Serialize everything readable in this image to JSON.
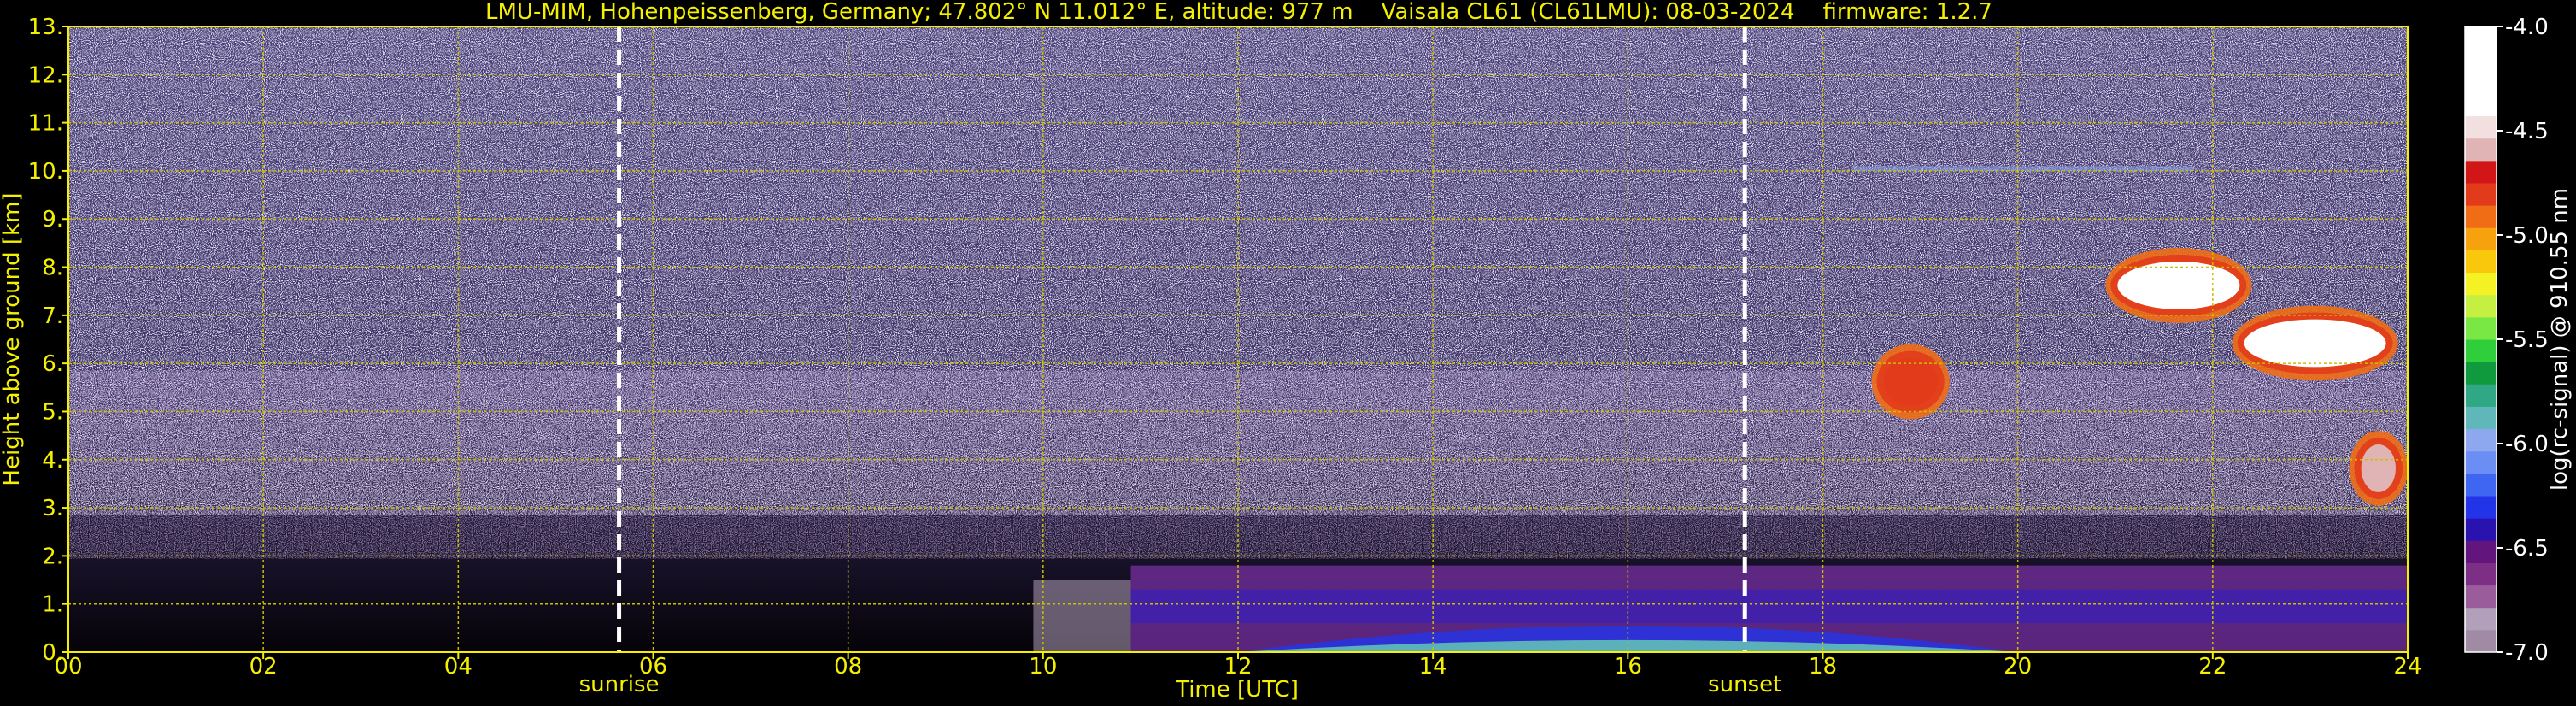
{
  "chart_data": {
    "type": "heatmap",
    "title": "LMU-MIM, Hohenpeissenberg, Germany; 47.802° N 11.012° E, altitude: 977 m    Vaisala CL61 (CL61LMU): 08-03-2024    firmware: 1.2.7",
    "xlabel": "Time [UTC]",
    "ylabel": "Height above ground [km]",
    "xlim": [
      0,
      24
    ],
    "ylim": [
      0,
      13
    ],
    "x_ticks": [
      "00",
      "02",
      "04",
      "06",
      "08",
      "10",
      "12",
      "14",
      "16",
      "18",
      "20",
      "22",
      "24"
    ],
    "x_tick_values": [
      0,
      2,
      4,
      6,
      8,
      10,
      12,
      14,
      16,
      18,
      20,
      22,
      24
    ],
    "y_ticks": [
      "0.",
      "1.",
      "2.",
      "3.",
      "4.",
      "5.",
      "6.",
      "7.",
      "8.",
      "9.",
      "10.",
      "11.",
      "12.",
      "13."
    ],
    "y_tick_values": [
      0,
      1,
      2,
      3,
      4,
      5,
      6,
      7,
      8,
      9,
      10,
      11,
      12,
      13
    ],
    "grid": true,
    "events": [
      {
        "label": "sunrise",
        "time": 5.65
      },
      {
        "label": "sunset",
        "time": 17.2
      }
    ],
    "colorbar": {
      "label": "log(rc-signal) @ 910.55 nm",
      "range": [
        -7.0,
        -4.0
      ],
      "ticks": [
        "-4.0",
        "-4.5",
        "-5.0",
        "-5.5",
        "-6.0",
        "-6.5",
        "-7.0"
      ],
      "tick_values": [
        -4.0,
        -4.5,
        -5.0,
        -5.5,
        -6.0,
        -6.5,
        -7.0
      ],
      "colors": [
        "#a08aa4",
        "#b2a0bb",
        "#9a5c9a",
        "#7d2f86",
        "#62157c",
        "#2a12b0",
        "#2334e8",
        "#3e66f2",
        "#6a8ef3",
        "#8ea8ef",
        "#5fb7b9",
        "#31a885",
        "#0f9a3e",
        "#2ecf3a",
        "#79e845",
        "#c6f041",
        "#f4f224",
        "#f9c70c",
        "#f6a20f",
        "#f06d16",
        "#e23b1b",
        "#d21617",
        "#e0b4b4",
        "#f2e0e0",
        "#ffffff",
        "#ffffff",
        "#ffffff",
        "#ffffff"
      ]
    },
    "features": [
      {
        "name": "boundary-layer aerosol",
        "t_start": 10.9,
        "t_end": 24,
        "z_top_km": 1.8,
        "log_signal": -6.3
      },
      {
        "name": "near-surface layer",
        "t_start": 12,
        "t_end": 20,
        "z_top_km": 0.5,
        "log_signal": -5.9
      },
      {
        "name": "morning aerosol plume",
        "t_start": 9.9,
        "t_end": 10.9,
        "z_top_km": 1.5,
        "log_signal": -6.6
      },
      {
        "name": "thin cirrus",
        "t_start": 18.3,
        "t_end": 21.8,
        "z_top_km": 10.1,
        "log_signal": -6.8
      },
      {
        "name": "cloud",
        "t_start": 18.5,
        "t_end": 19.3,
        "z_top_km": 6.4,
        "log_signal": -4.8
      },
      {
        "name": "cloud",
        "t_start": 20.9,
        "t_end": 22.4,
        "z_top_km": 8.4,
        "log_signal": -4.3
      },
      {
        "name": "cloud",
        "t_start": 22.2,
        "t_end": 23.9,
        "z_top_km": 7.2,
        "log_signal": -4.2
      },
      {
        "name": "cloud",
        "t_start": 23.4,
        "t_end": 24,
        "z_top_km": 4.6,
        "log_signal": -4.6
      }
    ]
  }
}
